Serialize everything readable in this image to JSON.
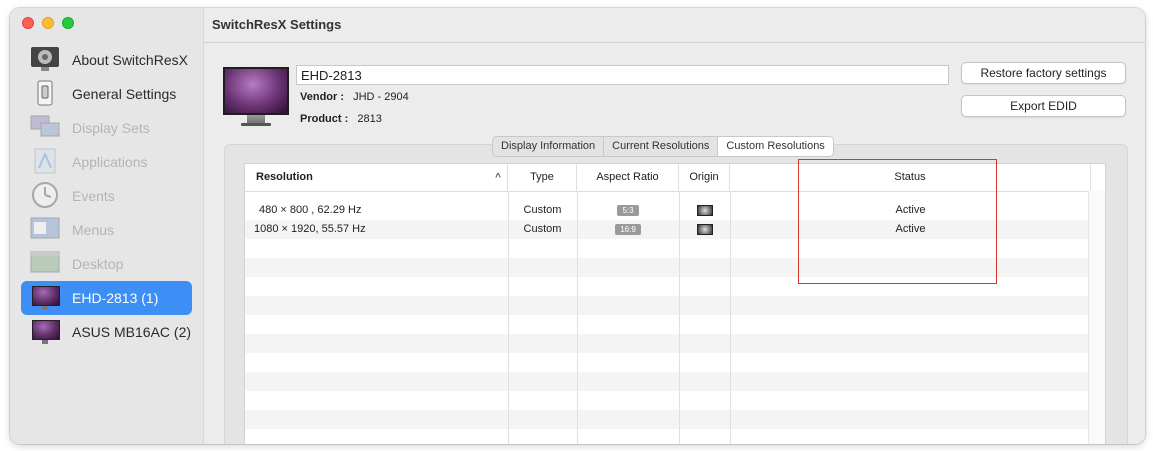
{
  "window": {
    "title": "SwitchResX Settings"
  },
  "sidebar": {
    "items": [
      {
        "label": "About SwitchResX",
        "icon": "switchresx-app-icon",
        "state": "normal"
      },
      {
        "label": "General Settings",
        "icon": "light-switch-icon",
        "state": "normal"
      },
      {
        "label": "Display Sets",
        "icon": "display-sets-icon",
        "state": "disabled"
      },
      {
        "label": "Applications",
        "icon": "applications-icon",
        "state": "disabled"
      },
      {
        "label": "Events",
        "icon": "clock-icon",
        "state": "disabled"
      },
      {
        "label": "Menus",
        "icon": "menus-icon",
        "state": "disabled"
      },
      {
        "label": "Desktop",
        "icon": "desktop-icon",
        "state": "disabled"
      },
      {
        "label": "EHD-2813 (1)",
        "icon": "monitor-icon",
        "state": "selected"
      },
      {
        "label": "ASUS MB16AC (2)",
        "icon": "monitor-icon",
        "state": "normal"
      }
    ]
  },
  "display": {
    "name": "EHD-2813",
    "vendor_label": "Vendor :",
    "vendor_value": "JHD - 2904",
    "product_label": "Product :",
    "product_value": "2813"
  },
  "buttons": {
    "restore": "Restore factory settings",
    "export": "Export EDID"
  },
  "tabs": [
    {
      "label": "Display Information",
      "active": false
    },
    {
      "label": "Current Resolutions",
      "active": false
    },
    {
      "label": "Custom Resolutions",
      "active": true
    }
  ],
  "table": {
    "columns": [
      "Resolution",
      "Type",
      "Aspect Ratio",
      "Origin",
      "Status"
    ],
    "sort_indicator": "^",
    "rows": [
      {
        "resolution": "480 × 800 , 62.29 Hz",
        "type": "Custom",
        "aspect": "5:3",
        "origin_icon": "monitor-origin-icon",
        "status": "Active"
      },
      {
        "resolution": "1080 × 1920, 55.57 Hz",
        "type": "Custom",
        "aspect": "16:9",
        "origin_icon": "monitor-origin-icon",
        "status": "Active"
      }
    ]
  },
  "colors": {
    "selection": "#3d8ef5",
    "highlight_box": "#d9362f"
  }
}
